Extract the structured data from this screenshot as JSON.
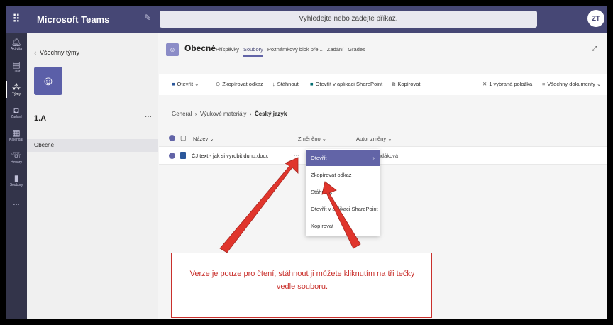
{
  "topbar": {
    "app_title": "Microsoft Teams",
    "search_placeholder": "Vyhledejte nebo zadejte příkaz.",
    "avatar_initials": "ZT"
  },
  "rail": {
    "items": [
      {
        "icon": "bell-icon",
        "label": "Aktivita"
      },
      {
        "icon": "chat-icon",
        "label": "Chat"
      },
      {
        "icon": "teams-icon",
        "label": "Týmy"
      },
      {
        "icon": "assignments-icon",
        "label": "Zadání"
      },
      {
        "icon": "calendar-icon",
        "label": "Kalendář"
      },
      {
        "icon": "phone-icon",
        "label": "Hovory"
      },
      {
        "icon": "files-icon",
        "label": "Soubory"
      }
    ],
    "more": "..."
  },
  "sidebar": {
    "back_label": "Všechny týmy",
    "team_name": "1.A",
    "team_more": "···",
    "channel": "Obecné"
  },
  "channel_header": {
    "title": "Obecné",
    "tabs": [
      "Příspěvky",
      "Soubory",
      "Poznámkový blok pře...",
      "Zadání",
      "Grades"
    ],
    "active_tab": "Soubory"
  },
  "toolbar": {
    "open": "Otevřít",
    "copy_link": "Zkopírovat odkaz",
    "download": "Stáhnout",
    "open_sharepoint": "Otevřít v aplikaci SharePoint",
    "copy": "Kopírovat",
    "selected": "1 vybraná položka",
    "all_docs": "Všechny dokumenty"
  },
  "breadcrumb": {
    "part1": "General",
    "part2": "Výukové materiály",
    "current": "Český jazyk"
  },
  "list": {
    "col_name": "Název",
    "col_modified": "Změněno",
    "col_author": "Autor změny",
    "row": {
      "name": "ČJ text - jak si vyrobit duhu.docx",
      "more": "···",
      "author": "Fundáková"
    }
  },
  "context_menu": {
    "items": [
      "Otevřít",
      "Zkopírovat odkaz",
      "Stáhnout",
      "Otevřít v aplikaci SharePoint",
      "Kopírovat"
    ]
  },
  "callout": {
    "text": "Verze je pouze pro čtení, stáhnout ji můžete kliknutím na tři tečky vedle souboru."
  },
  "colors": {
    "topbar": "#464775",
    "rail": "#33344a",
    "accent": "#6264a7",
    "annotation": "#c9302c"
  }
}
